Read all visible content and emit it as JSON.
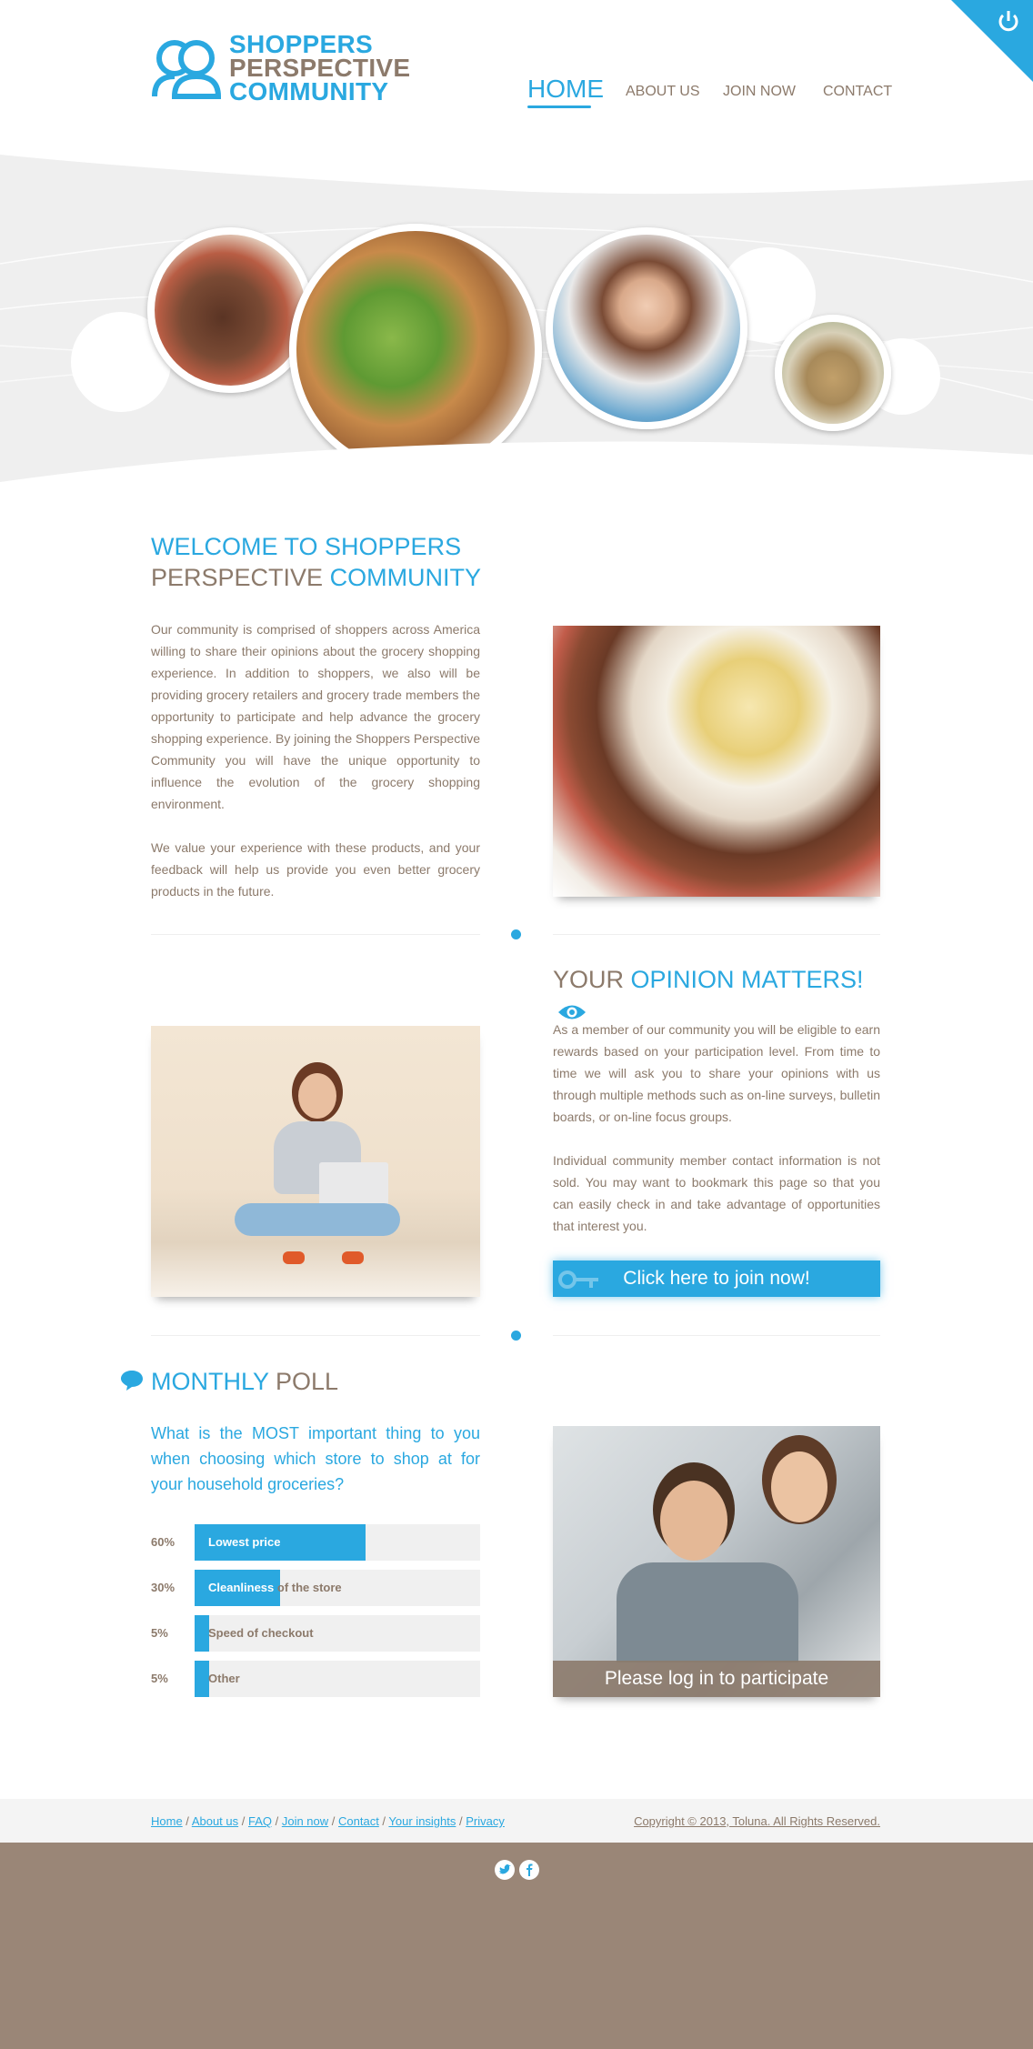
{
  "header": {
    "logo": {
      "line1": "SHOPPERS",
      "line2": "PERSPECTIVE",
      "line3": "COMMUNITY"
    },
    "nav": [
      {
        "label": "HOME",
        "active": true
      },
      {
        "label": "ABOUT US"
      },
      {
        "label": "JOIN NOW"
      },
      {
        "label": "CONTACT"
      }
    ],
    "corner_icon": "power-icon"
  },
  "welcome": {
    "title_line1": "WELCOME TO SHOPPERS",
    "title_line2a": "PERSPECTIVE",
    "title_line2b": "COMMUNITY",
    "p1": "Our community is comprised of shoppers across America willing to share their opinions about the grocery shopping experience. In addition to shoppers, we also will be providing grocery retailers and grocery trade members the opportunity to participate and help advance the grocery shopping experience. By joining the Shoppers Perspective Community you will have the unique opportunity to influence the evolution of the grocery shopping environment.",
    "p2": "We value your experience with these products, and your feedback will help us provide you even better grocery products in the future."
  },
  "opinion": {
    "title_a": "YOUR",
    "title_b": "OPINION MATTERS!",
    "icon": "eye-icon",
    "p1": "As a member of our community you will be eligible to earn rewards based on your participation level. From time to time we will ask you to share your opinions with us through multiple methods such as on-line surveys, bulletin boards, or on-line focus groups.",
    "p2": "Individual community member contact information is not sold. You may want to bookmark this page so that you can easily check in and take advantage of opportunities that interest you.",
    "cta": "Click here to join now!"
  },
  "poll": {
    "title_a": "MONTHLY",
    "title_b": "POLL",
    "icon": "speech-bubble-icon",
    "question": "What is the MOST important thing to you when choosing which store to shop at for your household groceries?",
    "options": [
      {
        "pct": "60%",
        "label": "Lowest price",
        "value": 0.6
      },
      {
        "pct": "30%",
        "label": "Cleanliness of the store",
        "value": 0.3
      },
      {
        "pct": "5%",
        "label": "Speed of checkout",
        "value": 0.05
      },
      {
        "pct": "5%",
        "label": "Other",
        "value": 0.05
      }
    ],
    "login_caption": "Please log in to participate"
  },
  "footer": {
    "links": [
      "Home",
      "About us",
      "FAQ",
      "Join now",
      "Contact",
      "Your insights",
      "Privacy"
    ],
    "copyright": "Copyright © 2013, Toluna. All Rights Reserved.",
    "social": [
      "twitter-icon",
      "facebook-icon"
    ]
  },
  "colors": {
    "accent": "#2aa8e0",
    "brown": "#8c7a6b",
    "footer": "#9a8677"
  }
}
